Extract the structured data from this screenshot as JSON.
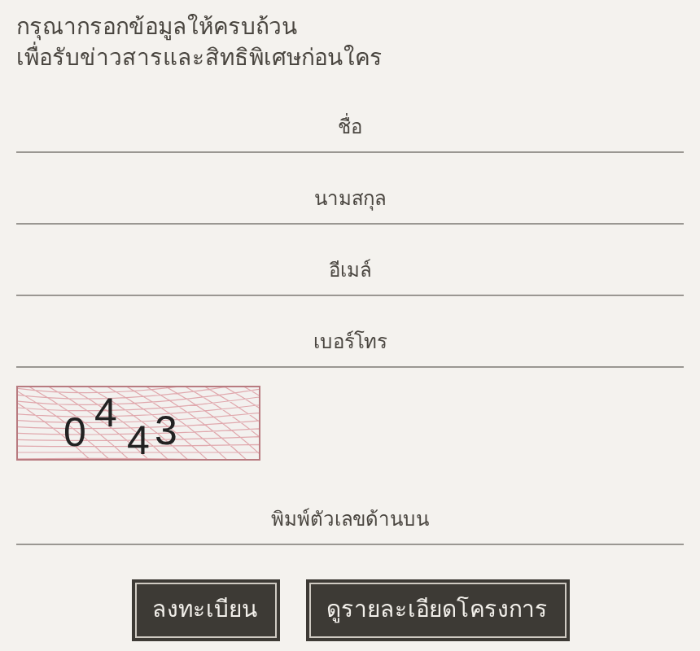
{
  "intro": [
    "กรุณากรอกข้อมูลให้ครบถ้วน",
    "เพื่อรับข่าวสารและสิทธิพิเศษก่อนใคร"
  ],
  "fields": [
    {
      "placeholder": "ชื่อ"
    },
    {
      "placeholder": "นามสกุล"
    },
    {
      "placeholder": "อีเมล์"
    },
    {
      "placeholder": "เบอร์โทร"
    }
  ],
  "captcha": {
    "digits": [
      "0",
      "4",
      "4",
      "3"
    ]
  },
  "captcha_field": {
    "placeholder": "พิมพ์ตัวเลขด้านบน"
  },
  "buttons": [
    "ลงทะเบียน",
    "ดูรายละเอียดโครงการ"
  ]
}
